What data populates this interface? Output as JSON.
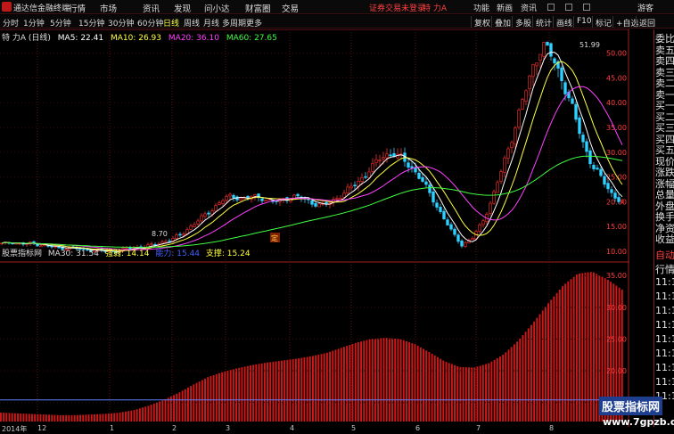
{
  "menubar": {
    "app_title": "通达信金融终端",
    "menus": [
      "行情",
      "市场",
      "资讯",
      "发现",
      "问小达",
      "财富圈",
      "交易"
    ],
    "alert": "证券交易未登录",
    "stock_name": "特 力A",
    "right_items": [
      "功能",
      "新画",
      "资讯",
      "游客"
    ]
  },
  "periodbar": {
    "periods": [
      "分时",
      "1分钟",
      "5分钟",
      "15分钟",
      "30分钟",
      "60分钟",
      "日线",
      "周线",
      "月线",
      "多周期",
      "更多"
    ],
    "active": "日线",
    "tools": [
      "复权",
      "叠加",
      "多股",
      "统计",
      "画线",
      "F10",
      "标记",
      "+自选",
      "返回"
    ]
  },
  "main_indicators": {
    "name": "特 力A (日线)",
    "ma5": "MA5: 22.41",
    "ma10": "MA10: 26.93",
    "ma20": "MA20: 36.10",
    "ma60": "MA60: 27.65",
    "colors": {
      "ma5": "#ffffff",
      "ma10": "#ffff40",
      "ma20": "#ff40ff",
      "ma60": "#40ff40"
    }
  },
  "sub_indicators": {
    "name": "股票指标网",
    "ma30": "MA30: 31.54",
    "pressure": "强弱: 14.14",
    "power": "能力: 15.44",
    "support": "支撑: 15.24"
  },
  "annotations": {
    "high": "51.99",
    "low": "8.70",
    "marker": "定"
  },
  "right_panel": {
    "labels": [
      "委比",
      "卖五",
      "卖四",
      "卖三",
      "卖二",
      "卖一",
      "买一",
      "买二",
      "买三",
      "买四",
      "买五",
      "现价",
      "涨跌",
      "涨幅",
      "总量",
      "外盘",
      "换手",
      "净资",
      "收益"
    ],
    "sub_labels": [
      "自动",
      "行情",
      "11:1",
      "11:1",
      "11:1",
      "11:1",
      "11:1",
      "11:1",
      "11:1",
      "11:1",
      "11:1"
    ]
  },
  "dates": [
    "2014年",
    "12",
    "1",
    "2",
    "3",
    "4",
    "5",
    "6",
    "7",
    "8"
  ],
  "watermark": {
    "line1": "股票指标网",
    "line2": "www.7gpzb.com"
  },
  "chart_data": [
    {
      "type": "candlestick",
      "y_ticks": [
        10,
        15,
        20,
        25,
        30,
        35,
        40,
        45,
        50
      ],
      "ylim": [
        8,
        53
      ],
      "series": [
        {
          "name": "MA5"
        },
        {
          "name": "MA10"
        },
        {
          "name": "MA20"
        },
        {
          "name": "MA60"
        }
      ],
      "close_path": [
        11.5,
        11.8,
        11.4,
        11.6,
        11.2,
        10.9,
        10.6,
        10.7,
        10.4,
        10.2,
        10.1,
        9.9,
        10.3,
        10.6,
        10.9,
        11.2,
        11.8,
        12.4,
        13.5,
        15.2,
        16.8,
        18.4,
        20.3,
        21.2,
        20.6,
        21.0,
        20.8,
        19.9,
        20.4,
        21.1,
        20.7,
        19.8,
        19.2,
        20.1,
        21.5,
        23.0,
        24.8,
        27.0,
        29.2,
        29.8,
        28.7,
        26.8,
        24.2,
        20.8,
        17.2,
        13.8,
        11.2,
        12.6,
        15.8,
        20.6,
        26.8,
        33.2,
        40.1,
        46.8,
        51.9,
        49.2,
        44.6,
        38.8,
        32.4,
        27.2,
        24.5,
        21.5,
        19.6
      ]
    },
    {
      "type": "bar",
      "y_ticks": [
        15,
        20,
        25,
        30,
        35
      ],
      "ylim": [
        12,
        37
      ],
      "values_path": [
        13.4,
        13.3,
        13.2,
        13.1,
        13.0,
        13.0,
        13.1,
        13.2,
        13.4,
        13.8,
        14.5,
        15.4,
        16.5,
        17.8,
        19.0,
        19.8,
        20.4,
        20.9,
        21.3,
        21.6,
        21.9,
        22.3,
        22.8,
        23.6,
        24.4,
        25.0,
        25.2,
        25.0,
        24.2,
        22.9,
        21.5,
        20.6,
        20.5,
        21.2,
        22.6,
        24.8,
        27.6,
        30.6,
        33.4,
        35.3,
        35.6,
        34.4,
        32.8
      ],
      "horizontal_line": 15.4
    }
  ]
}
